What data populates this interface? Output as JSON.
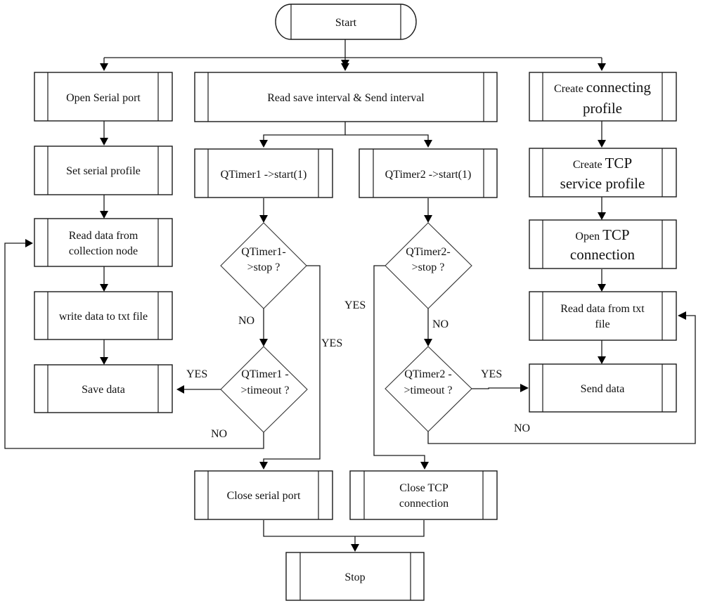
{
  "diagram": {
    "type": "flowchart",
    "nodes": {
      "start": {
        "label": "Start",
        "shape": "terminator"
      },
      "open_serial": {
        "label": "Open Serial port",
        "shape": "predefined-process"
      },
      "read_intervals": {
        "label": "Read save interval & Send interval",
        "shape": "predefined-process"
      },
      "create_connecting": {
        "label_small": "Create",
        "label_big": "connecting",
        "label_line2": "profile",
        "shape": "predefined-process"
      },
      "set_serial": {
        "label": "Set serial profile",
        "shape": "predefined-process"
      },
      "qtimer1_start": {
        "label": "QTimer1 ->start(1)",
        "shape": "predefined-process"
      },
      "qtimer2_start": {
        "label": "QTimer2 ->start(1)",
        "shape": "predefined-process"
      },
      "create_tcp": {
        "label_small": "Create",
        "label_big": "TCP",
        "label_line2": "service profile",
        "shape": "predefined-process"
      },
      "read_collection": {
        "line1": "Read data from",
        "line2": "collection node",
        "shape": "predefined-process"
      },
      "qtimer1_stop": {
        "line1": "QTimer1-",
        "line2": ">stop ?",
        "shape": "decision"
      },
      "qtimer2_stop": {
        "line1": "QTimer2-",
        "line2": ">stop ?",
        "shape": "decision"
      },
      "open_tcp": {
        "label_small": "Open",
        "label_big": "TCP",
        "label_line2": "connection",
        "shape": "predefined-process"
      },
      "write_txt": {
        "label": "write data to txt file",
        "shape": "predefined-process"
      },
      "read_txt": {
        "line1": "Read data from txt",
        "line2": "file",
        "shape": "predefined-process"
      },
      "save_data": {
        "label": "Save data",
        "shape": "predefined-process"
      },
      "qtimer1_timeout": {
        "line1": "QTimer1 -",
        "line2": ">timeout ?",
        "shape": "decision"
      },
      "qtimer2_timeout": {
        "line1": "QTimer2 -",
        "line2": ">timeout ?",
        "shape": "decision"
      },
      "send_data": {
        "label": "Send data",
        "shape": "predefined-process"
      },
      "close_serial": {
        "label": "Close serial port",
        "shape": "predefined-process"
      },
      "close_tcp": {
        "line1": "Close TCP",
        "line2": "connection",
        "shape": "predefined-process"
      },
      "stop": {
        "label": "Stop",
        "shape": "predefined-process"
      }
    },
    "edge_labels": {
      "q1_stop_no": "NO",
      "q1_stop_yes": "YES",
      "q1_timeout_yes": "YES",
      "q1_timeout_no": "NO",
      "q2_stop_yes": "YES",
      "q2_stop_no": "NO",
      "q2_timeout_yes": "YES",
      "q2_timeout_no": "NO"
    },
    "colors": {
      "stroke": "#1a1a1a",
      "background": "#ffffff",
      "text": "#111111"
    }
  }
}
